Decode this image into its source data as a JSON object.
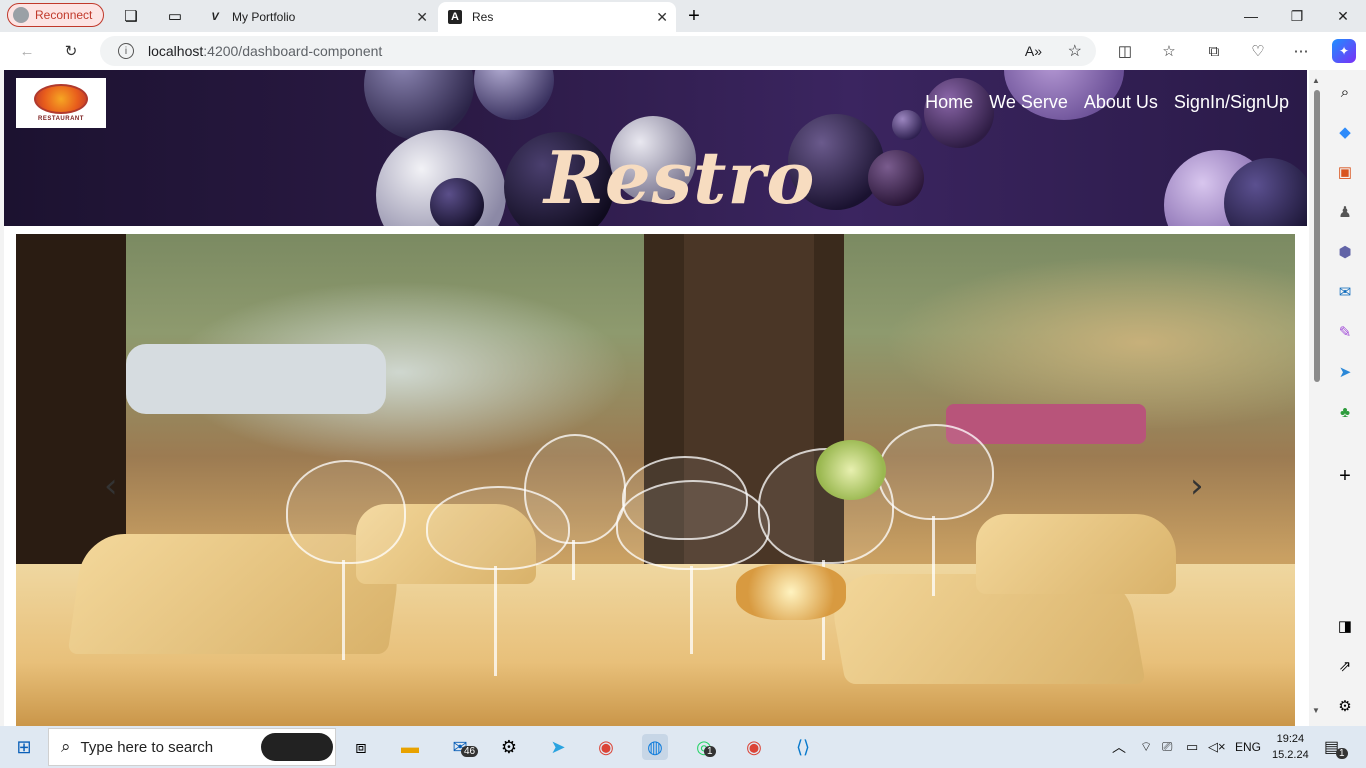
{
  "browser": {
    "reconnect_label": "Reconnect",
    "tabs": [
      {
        "title": "My Portfolio",
        "favicon": "V",
        "active": false
      },
      {
        "title": "Res",
        "favicon": "angular-icon",
        "active": true
      }
    ],
    "url_host": "localhost",
    "url_path": ":4200/dashboard-component"
  },
  "site": {
    "nav": [
      "Home",
      "We Serve",
      "About Us",
      "SignIn/SignUp"
    ],
    "brand": "Restro",
    "logo_text": "RESTAURANT",
    "carousel_prev": "‹",
    "carousel_next": "›"
  },
  "taskbar": {
    "search_placeholder": "Type here to search",
    "mail_badge": "46",
    "whatsapp_badge": "1",
    "language": "ENG",
    "time": "19:24",
    "date": "15.2.24",
    "notification_badge": "1"
  },
  "colors": {
    "hero_bg": "#2b1a45",
    "brand_text": "#f7dcc0",
    "reconnect": "#c0392b"
  }
}
